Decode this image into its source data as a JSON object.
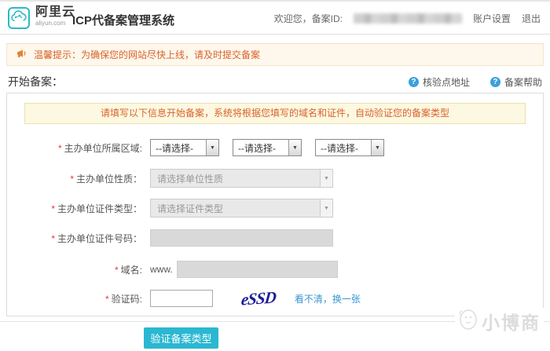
{
  "header": {
    "brand": "阿里云",
    "brand_domain": "aliyun.com",
    "title": "ICP代备案管理系统",
    "welcome": "欢迎您，备案ID:",
    "account_settings": "账户设置",
    "logout": "退出"
  },
  "notice": {
    "text": "温馨提示：为确保您的网站尽快上线，请及时提交备案"
  },
  "section": {
    "title": "开始备案：",
    "links": [
      {
        "label": "核验点地址"
      },
      {
        "label": "备案帮助"
      }
    ]
  },
  "form": {
    "instruction": "请填写以下信息开始备案，系统将根据您填写的域名和证件，自动验证您的备案类型",
    "required_mark": "*",
    "region": {
      "label": "主办单位所属区域:",
      "selects": [
        "--请选择-",
        "--请选择-",
        "--请选择-"
      ]
    },
    "org_nature": {
      "label": "主办单位性质：",
      "placeholder": "请选择单位性质"
    },
    "cert_type": {
      "label": "主办单位证件类型：",
      "placeholder": "请选择证件类型"
    },
    "cert_number": {
      "label": "主办单位证件号码：",
      "value": ""
    },
    "domain": {
      "label": "域名:",
      "prefix": "www.",
      "value": ""
    },
    "captcha": {
      "label": "验证码:",
      "value": "",
      "image_text": "eSSD",
      "refresh": "看不清，换一张"
    },
    "submit": "验证备案类型"
  },
  "icons": {
    "help": "?",
    "select_arrow": "▼"
  },
  "watermark": {
    "text": "小博商"
  },
  "colors": {
    "accent": "#2ab7d2",
    "orange": "#d9632b",
    "link_blue": "#3a96d2",
    "brand_teal": "#2fb8c6"
  }
}
